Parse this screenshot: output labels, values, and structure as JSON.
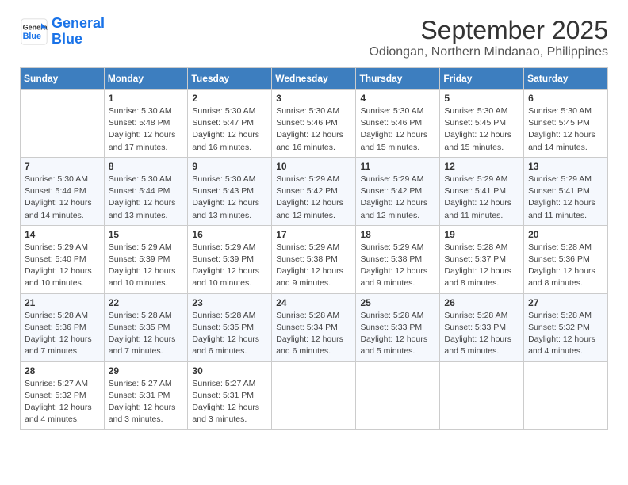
{
  "header": {
    "logo_line1": "General",
    "logo_line2": "Blue",
    "month": "September 2025",
    "location": "Odiongan, Northern Mindanao, Philippines"
  },
  "weekdays": [
    "Sunday",
    "Monday",
    "Tuesday",
    "Wednesday",
    "Thursday",
    "Friday",
    "Saturday"
  ],
  "weeks": [
    [
      {
        "day": "",
        "info": ""
      },
      {
        "day": "1",
        "info": "Sunrise: 5:30 AM\nSunset: 5:48 PM\nDaylight: 12 hours\nand 17 minutes."
      },
      {
        "day": "2",
        "info": "Sunrise: 5:30 AM\nSunset: 5:47 PM\nDaylight: 12 hours\nand 16 minutes."
      },
      {
        "day": "3",
        "info": "Sunrise: 5:30 AM\nSunset: 5:46 PM\nDaylight: 12 hours\nand 16 minutes."
      },
      {
        "day": "4",
        "info": "Sunrise: 5:30 AM\nSunset: 5:46 PM\nDaylight: 12 hours\nand 15 minutes."
      },
      {
        "day": "5",
        "info": "Sunrise: 5:30 AM\nSunset: 5:45 PM\nDaylight: 12 hours\nand 15 minutes."
      },
      {
        "day": "6",
        "info": "Sunrise: 5:30 AM\nSunset: 5:45 PM\nDaylight: 12 hours\nand 14 minutes."
      }
    ],
    [
      {
        "day": "7",
        "info": "Sunrise: 5:30 AM\nSunset: 5:44 PM\nDaylight: 12 hours\nand 14 minutes."
      },
      {
        "day": "8",
        "info": "Sunrise: 5:30 AM\nSunset: 5:44 PM\nDaylight: 12 hours\nand 13 minutes."
      },
      {
        "day": "9",
        "info": "Sunrise: 5:30 AM\nSunset: 5:43 PM\nDaylight: 12 hours\nand 13 minutes."
      },
      {
        "day": "10",
        "info": "Sunrise: 5:29 AM\nSunset: 5:42 PM\nDaylight: 12 hours\nand 12 minutes."
      },
      {
        "day": "11",
        "info": "Sunrise: 5:29 AM\nSunset: 5:42 PM\nDaylight: 12 hours\nand 12 minutes."
      },
      {
        "day": "12",
        "info": "Sunrise: 5:29 AM\nSunset: 5:41 PM\nDaylight: 12 hours\nand 11 minutes."
      },
      {
        "day": "13",
        "info": "Sunrise: 5:29 AM\nSunset: 5:41 PM\nDaylight: 12 hours\nand 11 minutes."
      }
    ],
    [
      {
        "day": "14",
        "info": "Sunrise: 5:29 AM\nSunset: 5:40 PM\nDaylight: 12 hours\nand 10 minutes."
      },
      {
        "day": "15",
        "info": "Sunrise: 5:29 AM\nSunset: 5:39 PM\nDaylight: 12 hours\nand 10 minutes."
      },
      {
        "day": "16",
        "info": "Sunrise: 5:29 AM\nSunset: 5:39 PM\nDaylight: 12 hours\nand 10 minutes."
      },
      {
        "day": "17",
        "info": "Sunrise: 5:29 AM\nSunset: 5:38 PM\nDaylight: 12 hours\nand 9 minutes."
      },
      {
        "day": "18",
        "info": "Sunrise: 5:29 AM\nSunset: 5:38 PM\nDaylight: 12 hours\nand 9 minutes."
      },
      {
        "day": "19",
        "info": "Sunrise: 5:28 AM\nSunset: 5:37 PM\nDaylight: 12 hours\nand 8 minutes."
      },
      {
        "day": "20",
        "info": "Sunrise: 5:28 AM\nSunset: 5:36 PM\nDaylight: 12 hours\nand 8 minutes."
      }
    ],
    [
      {
        "day": "21",
        "info": "Sunrise: 5:28 AM\nSunset: 5:36 PM\nDaylight: 12 hours\nand 7 minutes."
      },
      {
        "day": "22",
        "info": "Sunrise: 5:28 AM\nSunset: 5:35 PM\nDaylight: 12 hours\nand 7 minutes."
      },
      {
        "day": "23",
        "info": "Sunrise: 5:28 AM\nSunset: 5:35 PM\nDaylight: 12 hours\nand 6 minutes."
      },
      {
        "day": "24",
        "info": "Sunrise: 5:28 AM\nSunset: 5:34 PM\nDaylight: 12 hours\nand 6 minutes."
      },
      {
        "day": "25",
        "info": "Sunrise: 5:28 AM\nSunset: 5:33 PM\nDaylight: 12 hours\nand 5 minutes."
      },
      {
        "day": "26",
        "info": "Sunrise: 5:28 AM\nSunset: 5:33 PM\nDaylight: 12 hours\nand 5 minutes."
      },
      {
        "day": "27",
        "info": "Sunrise: 5:28 AM\nSunset: 5:32 PM\nDaylight: 12 hours\nand 4 minutes."
      }
    ],
    [
      {
        "day": "28",
        "info": "Sunrise: 5:27 AM\nSunset: 5:32 PM\nDaylight: 12 hours\nand 4 minutes."
      },
      {
        "day": "29",
        "info": "Sunrise: 5:27 AM\nSunset: 5:31 PM\nDaylight: 12 hours\nand 3 minutes."
      },
      {
        "day": "30",
        "info": "Sunrise: 5:27 AM\nSunset: 5:31 PM\nDaylight: 12 hours\nand 3 minutes."
      },
      {
        "day": "",
        "info": ""
      },
      {
        "day": "",
        "info": ""
      },
      {
        "day": "",
        "info": ""
      },
      {
        "day": "",
        "info": ""
      }
    ]
  ]
}
